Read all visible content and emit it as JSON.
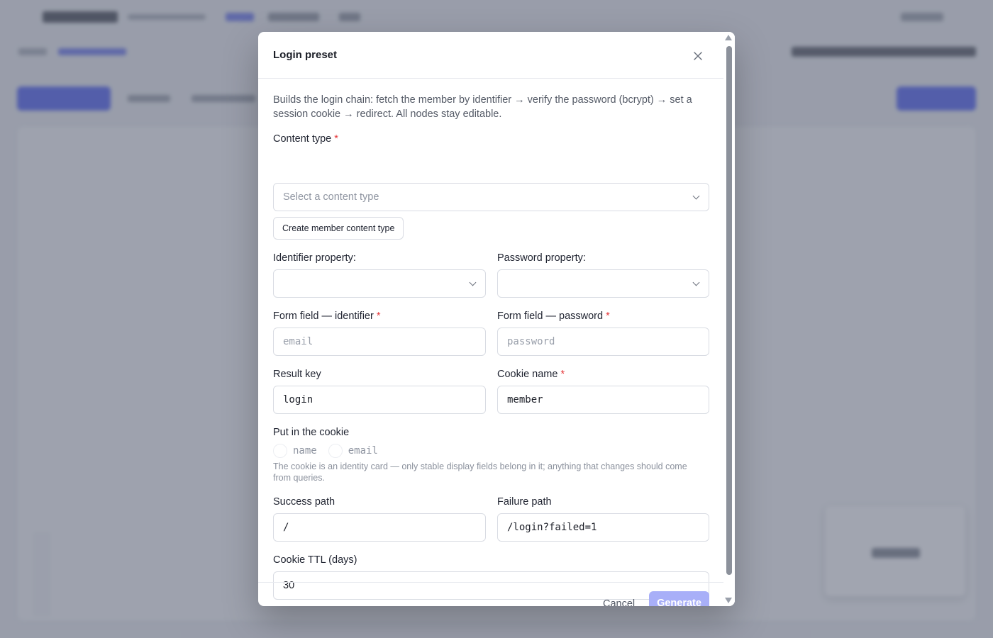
{
  "modal": {
    "title": "Login preset",
    "description": "Builds the login chain: fetch the member by identifier → verify the password (bcrypt) → set a session cookie → redirect. All nodes stay editable.",
    "content_type": {
      "label": "Content type",
      "required_mark": "*",
      "placeholder": "Select a content type"
    },
    "create_button": "Create member content type",
    "identifier_property": {
      "label": "Identifier property:",
      "value": ""
    },
    "password_property": {
      "label": "Password property:",
      "value": ""
    },
    "form_field_identifier": {
      "label": "Form field — identifier",
      "required_mark": "*",
      "placeholder": "email",
      "value": ""
    },
    "form_field_password": {
      "label": "Form field — password",
      "required_mark": "*",
      "placeholder": "password",
      "value": ""
    },
    "result_key": {
      "label": "Result key",
      "value": "login"
    },
    "cookie_name": {
      "label": "Cookie name",
      "required_mark": "*",
      "value": "member"
    },
    "cookie_fields": {
      "label": "Put in the cookie",
      "options": [
        "name",
        "email"
      ],
      "hint": "The cookie is an identity card — only stable display fields belong in it; anything that changes should come from queries."
    },
    "success_path": {
      "label": "Success path",
      "value": "/"
    },
    "failure_path": {
      "label": "Failure path",
      "value": "/login?failed=1"
    },
    "cookie_ttl": {
      "label": "Cookie TTL (days)",
      "value": "30"
    },
    "footer": {
      "cancel": "Cancel",
      "generate": "Generate"
    }
  },
  "colors": {
    "accent": "#3345f0",
    "accent_disabled": "#a8aff8",
    "required": "#e5383b",
    "overlay": "#686e80"
  },
  "icons": {
    "close": "close-icon",
    "select_chevron": "chevron-down-icon"
  }
}
